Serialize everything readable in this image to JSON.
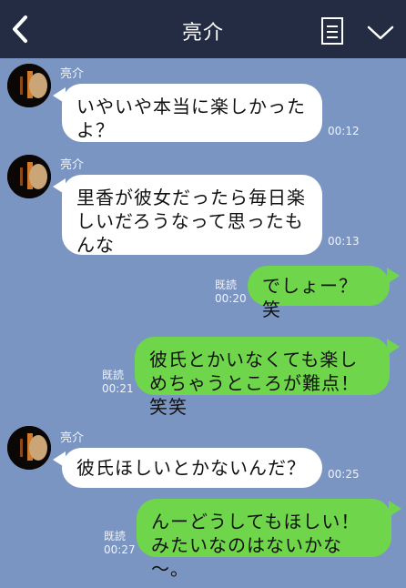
{
  "header": {
    "title": "亮介",
    "back_icon": "chevron-left-icon",
    "memo_icon": "note-icon",
    "menu_icon": "chevron-down-icon"
  },
  "colors": {
    "background": "#7b95c2",
    "header": "#232c42",
    "incoming_bubble": "#ffffff",
    "outgoing_bubble": "#6fd64b"
  },
  "messages": [
    {
      "direction": "in",
      "sender": "亮介",
      "text": "いやいや本当に楽しかったよ？",
      "time": "00:12"
    },
    {
      "direction": "in",
      "sender": "亮介",
      "text": "里香が彼女だったら毎日楽しいだろうなって思ったもんな",
      "time": "00:13"
    },
    {
      "direction": "out",
      "read": "既読",
      "text": "でしょー？笑",
      "time": "00:20"
    },
    {
      "direction": "out",
      "read": "既読",
      "text": "彼氏とかいなくても楽しめちゃうところが難点！笑笑",
      "time": "00:21"
    },
    {
      "direction": "in",
      "sender": "亮介",
      "text": "彼氏ほしいとかないんだ？",
      "time": "00:25"
    },
    {
      "direction": "out",
      "read": "既読",
      "text": "んーどうしてもほしい！みたいなのはないかな～。",
      "time": "00:27"
    }
  ]
}
